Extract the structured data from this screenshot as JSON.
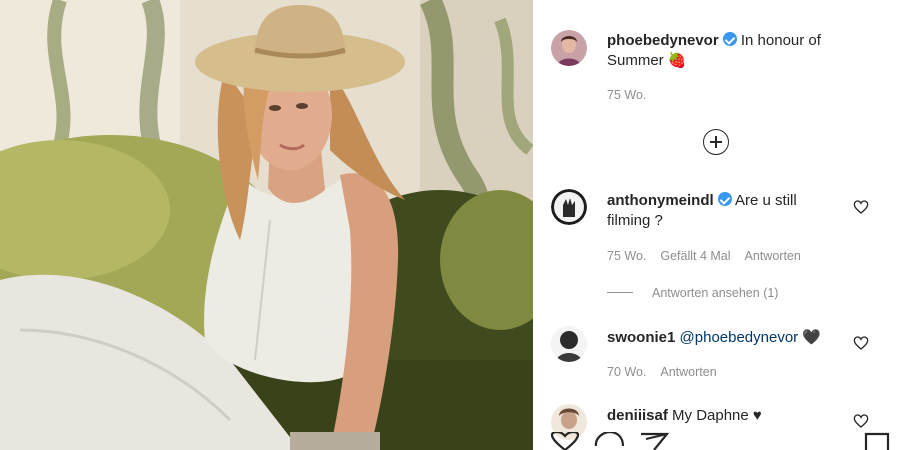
{
  "post": {
    "author": "phoebedynevor",
    "caption": "In honour of",
    "caption_line2": "Summer",
    "caption_emoji": "🍓",
    "age": "75 Wo."
  },
  "comments": [
    {
      "username": "anthonymeindl",
      "text_line1": "Are u still",
      "text_line2": "filming ?",
      "age": "75 Wo.",
      "likes": "Gefällt 4 Mal",
      "reply": "Antworten",
      "view_replies": "Antworten ansehen (1)"
    },
    {
      "username": "swoonie1",
      "mention": "@phoebedynevor",
      "emoji": "🖤",
      "age": "70 Wo.",
      "reply": "Antworten"
    },
    {
      "username": "deniiisaf",
      "text": "My Daphne ♥"
    }
  ],
  "icons": {
    "add_comments": "plus-circle-icon",
    "like": "heart-icon",
    "comment": "comment-icon",
    "share": "paper-plane-icon",
    "save": "bookmark-icon"
  },
  "colors": {
    "verified": "#3897f0",
    "mention": "#00376b",
    "meta": "#8e8e8e"
  }
}
